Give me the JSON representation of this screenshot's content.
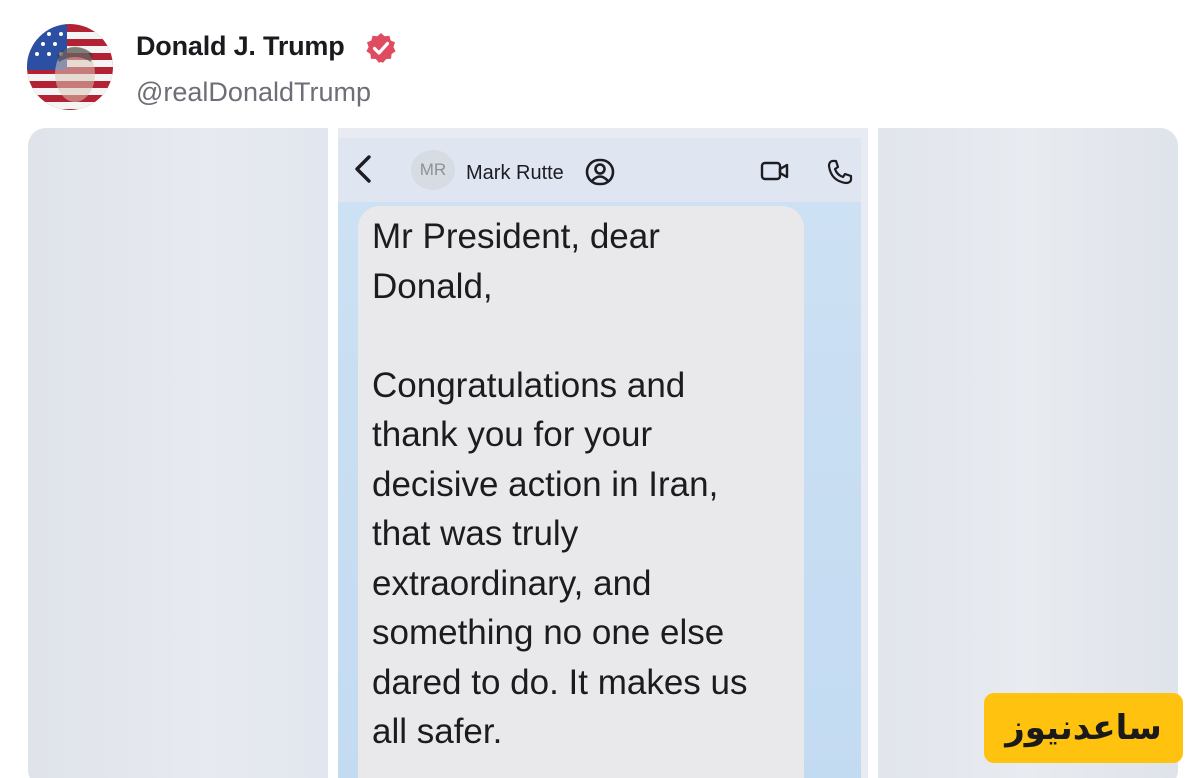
{
  "post": {
    "display_name": "Donald J. Trump",
    "handle": "@realDonaldTrump",
    "verified_icon": "verified-badge-icon",
    "verified_color": "#e04c5f"
  },
  "screenshot": {
    "contact_initials": "MR",
    "contact_name": "Mark Rutte",
    "icons": [
      "back-chevron-icon",
      "contact-info-icon",
      "video-call-icon",
      "phone-call-icon"
    ],
    "message": "Mr President, dear\nDonald,\n\nCongratulations and\nthank you for your\ndecisive action in Iran,\nthat was truly\nextraordinary, and\nsomething no one else\ndared to do.  It makes us\nall safer."
  },
  "watermark": {
    "text": "ساعدنیوز",
    "background": "#ffc20e"
  }
}
